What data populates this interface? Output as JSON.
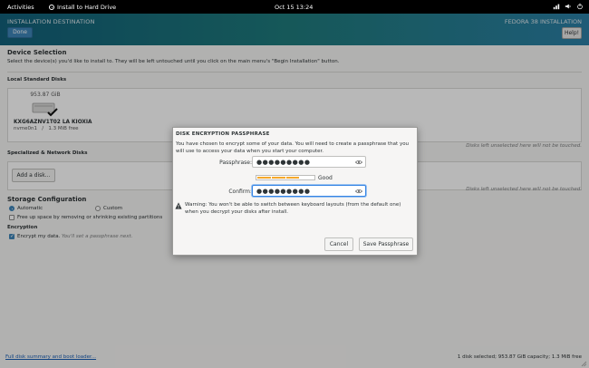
{
  "topbar": {
    "activities": "Activities",
    "app_name": "Install to Hard Drive",
    "clock": "Oct 15  13:24"
  },
  "header": {
    "title": "INSTALLATION DESTINATION",
    "done_label": "Done",
    "product": "FEDORA 38 INSTALLATION",
    "help_label": "Help!"
  },
  "device_selection": {
    "heading": "Device Selection",
    "instructions": "Select the device(s) you'd like to install to.  They will be left untouched until you click on the main menu's \"Begin Installation\" button.",
    "local_heading": "Local Standard Disks",
    "disk": {
      "capacity": "953.87 GiB",
      "model": "KXG6AZNV1T02 LA KIOXIA",
      "device": "nvme0n1",
      "free": "1.3 MiB free"
    },
    "unselected_note": "Disks left unselected here will not be touched."
  },
  "specialized": {
    "heading": "Specialized & Network Disks",
    "add_disk_label": "Add a disk...",
    "unselected_note": "Disks left unselected here will not be touched."
  },
  "storage_config": {
    "heading": "Storage Configuration",
    "automatic_label": "Automatic",
    "custom_label": "Custom",
    "free_up_label": "Free up space by removing or shrinking existing partitions",
    "encryption_heading": "Encryption",
    "encrypt_label": "Encrypt my data.",
    "encrypt_note": "You'll set a passphrase next."
  },
  "bottom": {
    "summary_link": "Full disk summary and boot loader...",
    "status": "1 disk selected; 953.87 GiB capacity; 1.3 MiB free"
  },
  "dialog": {
    "title": "DISK ENCRYPTION PASSPHRASE",
    "description": "You have chosen to encrypt some of your data. You will need to create a passphrase that you will use to access your data when you start your computer.",
    "passphrase_label": "Passphrase:",
    "passphrase_value": "●●●●●●●●●",
    "strength_label": "Good",
    "strength_fraction": 0.75,
    "confirm_label": "Confirm:",
    "confirm_value": "●●●●●●●●●",
    "warning": "Warning: You won't be able to switch between keyboard layouts (from the default one) when you decrypt your disks after install.",
    "cancel_label": "Cancel",
    "save_label": "Save Passphrase"
  },
  "colors": {
    "header_start": "#12607a",
    "header_end": "#2b7fa5",
    "accent": "#3d84b8",
    "strength": "#f5a82b",
    "focus": "#3584e4"
  },
  "icons": [
    "app-icon",
    "network-icon",
    "volume-icon",
    "power-icon",
    "hard-drive-icon",
    "selected-check-icon",
    "eye-icon",
    "warning-icon"
  ]
}
